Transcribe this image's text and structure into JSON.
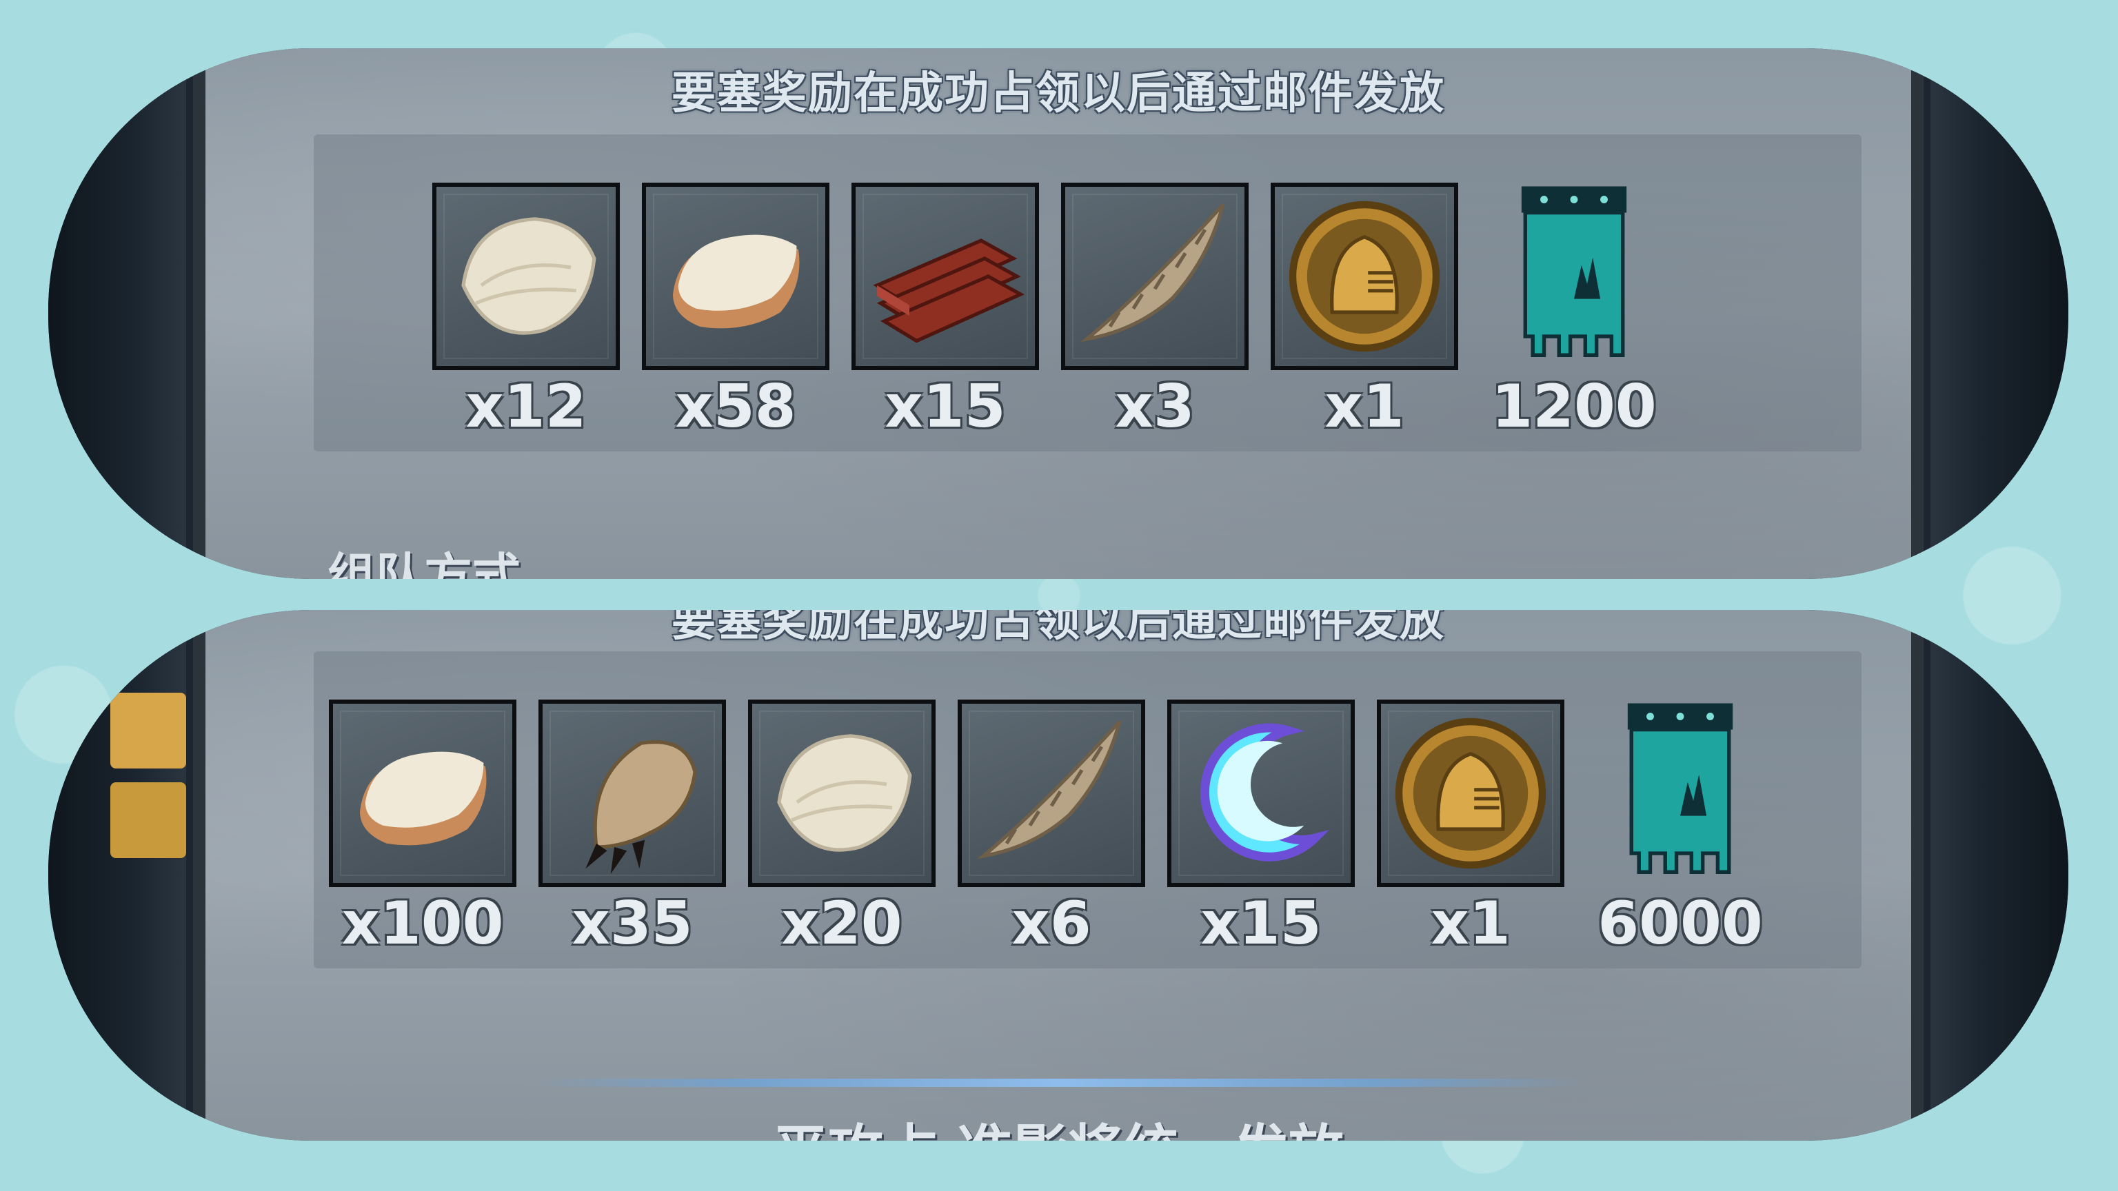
{
  "top_panel": {
    "notice": "要塞奖励在成功占领以后通过邮件发放",
    "items": [
      {
        "icon": "white-fur-icon",
        "qty": "x12"
      },
      {
        "icon": "pelt-icon",
        "qty": "x58"
      },
      {
        "icon": "wood-planks-icon",
        "qty": "x15"
      },
      {
        "icon": "spiral-horn-icon",
        "qty": "x3"
      },
      {
        "icon": "knight-helmet-medal-icon",
        "qty": "x1"
      }
    ],
    "banner": {
      "icon": "crescent-castle-banner-icon",
      "qty": "1200"
    },
    "lower_text": "组队方式"
  },
  "bottom_panel": {
    "notice": "要塞奖励在成功占领以后通过邮件发放",
    "items": [
      {
        "icon": "pelt-icon",
        "qty": "x100"
      },
      {
        "icon": "clawed-paw-icon",
        "qty": "x35"
      },
      {
        "icon": "white-fur-icon",
        "qty": "x20"
      },
      {
        "icon": "spiral-horn-icon",
        "qty": "x6"
      },
      {
        "icon": "crescent-flame-icon",
        "qty": "x15"
      },
      {
        "icon": "knight-helmet-medal-icon",
        "qty": "x1"
      }
    ],
    "banner": {
      "icon": "crescent-castle-banner-icon",
      "qty": "6000"
    },
    "lower_text": "平攻占 准影将统一发放"
  },
  "colors": {
    "background": "#a7dde0",
    "panel_frame": "#9aa4ad",
    "banner_teal": "#1ea5a0",
    "text": "#e8eef2"
  }
}
